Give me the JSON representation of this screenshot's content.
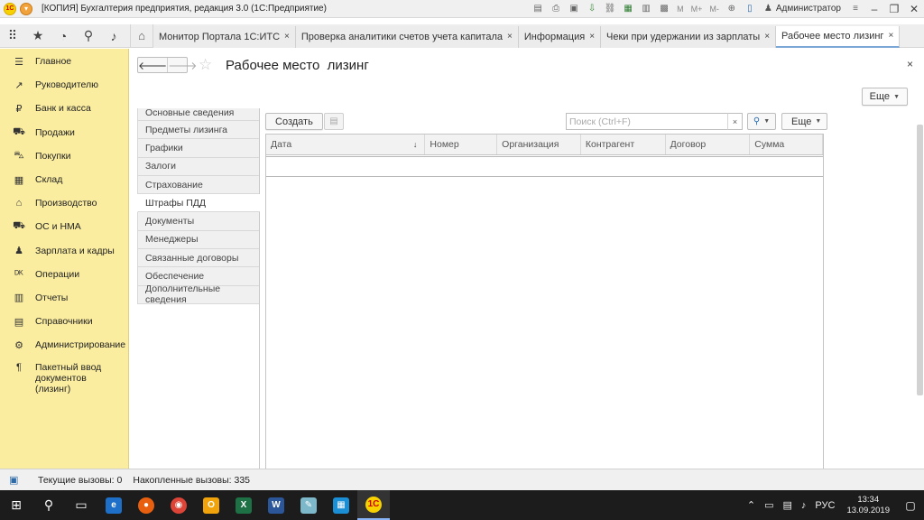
{
  "window": {
    "title": "[КОПИЯ] Бухгалтерия предприятия, редакция 3.0  (1С:Предприятие)",
    "logo_text": "1С",
    "user": "Администратор",
    "m_label": "M",
    "mplus_label": "M+",
    "mminus_label": "M-"
  },
  "tabs": [
    {
      "label": "Монитор Портала 1С:ИТС",
      "close": "×"
    },
    {
      "label": "Проверка аналитики счетов учета капитала",
      "close": "×"
    },
    {
      "label": "Информация",
      "close": "×"
    },
    {
      "label": "Чеки при удержании из зарплаты",
      "close": "×"
    },
    {
      "label": "Рабочее место  лизинг",
      "close": "×"
    }
  ],
  "sidebar": {
    "items": [
      {
        "label": "Главное",
        "icon": "list-icon"
      },
      {
        "label": "Руководителю",
        "icon": "trend-icon"
      },
      {
        "label": "Банк и касса",
        "icon": "ruble-icon"
      },
      {
        "label": "Продажи",
        "icon": "cart-icon"
      },
      {
        "label": "Покупки",
        "icon": "basket-icon"
      },
      {
        "label": "Склад",
        "icon": "warehouse-icon"
      },
      {
        "label": "Производство",
        "icon": "factory-icon"
      },
      {
        "label": "ОС и НМА",
        "icon": "truck-icon"
      },
      {
        "label": "Зарплата и кадры",
        "icon": "people-icon"
      },
      {
        "label": "Операции",
        "icon": "operations-icon"
      },
      {
        "label": "Отчеты",
        "icon": "chart-icon"
      },
      {
        "label": "Справочники",
        "icon": "book-icon"
      },
      {
        "label": "Администрирование",
        "icon": "gear-icon"
      },
      {
        "label": "Пакетный ввод документов (лизинг)",
        "icon": "pilcrow-icon"
      }
    ]
  },
  "form": {
    "title": "Рабочее место  лизинг",
    "more_label": "Еще",
    "close": "×"
  },
  "sections": [
    {
      "label": "Основные сведения"
    },
    {
      "label": "Предметы лизинга"
    },
    {
      "label": "Графики"
    },
    {
      "label": "Залоги"
    },
    {
      "label": "Страхование"
    },
    {
      "label": "Штрафы ПДД"
    },
    {
      "label": "Документы"
    },
    {
      "label": "Менеджеры"
    },
    {
      "label": "Связанные договоры"
    },
    {
      "label": "Обеспечение"
    },
    {
      "label": "Дополнительные сведения"
    }
  ],
  "toolbar": {
    "create_label": "Создать",
    "search_placeholder": "Поиск (Ctrl+F)",
    "clear": "×",
    "more_label": "Еще"
  },
  "table": {
    "columns": [
      {
        "label": "Дата",
        "width": 177
      },
      {
        "label": "Номер",
        "width": 80
      },
      {
        "label": "Организация",
        "width": 93
      },
      {
        "label": "Контрагент",
        "width": 94
      },
      {
        "label": "Договор",
        "width": 94
      },
      {
        "label": "Сумма",
        "width": 81
      }
    ],
    "sort_indicator": "↓"
  },
  "status": {
    "current_calls": "Текущие вызовы: 0",
    "accumulated_calls": "Накопленные вызовы: 335"
  },
  "taskbar": {
    "language": "РУС",
    "time": "13:34",
    "date": "13.09.2019"
  }
}
